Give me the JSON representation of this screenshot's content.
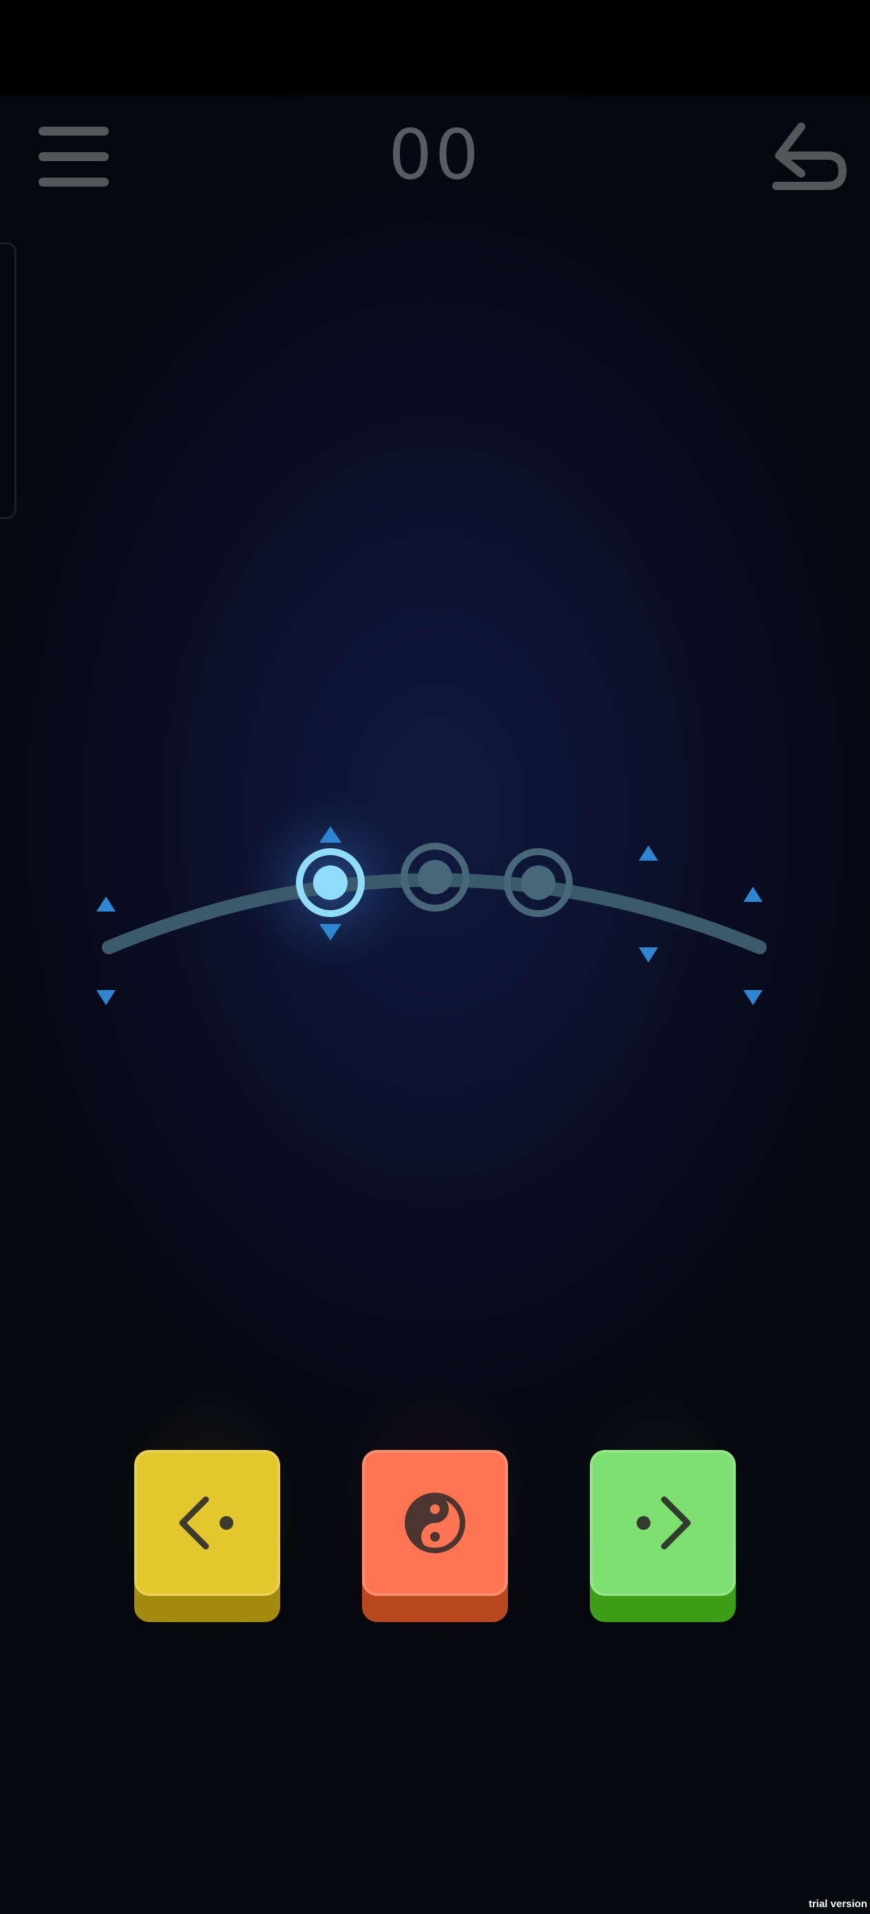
{
  "header": {
    "menu_icon": "hamburger-menu-icon",
    "move_count": "00",
    "undo_icon": "undo-arrow-icon"
  },
  "puzzle": {
    "track": "arc",
    "nodes": [
      {
        "state": "active",
        "color": "#8fdcfb"
      },
      {
        "state": "inactive",
        "color": "#466878"
      },
      {
        "state": "inactive",
        "color": "#466878"
      }
    ],
    "arrow_color": "#2e86d2",
    "track_color": "#3b5a6c"
  },
  "controls": {
    "left_key": {
      "icon": "chevron-left-dot-icon",
      "color": "#e4c62d"
    },
    "center_key": {
      "icon": "yin-yang-icon",
      "color": "#ff7551"
    },
    "right_key": {
      "icon": "chevron-right-dot-icon",
      "color": "#7ddf70"
    }
  },
  "watermark": "trial version"
}
